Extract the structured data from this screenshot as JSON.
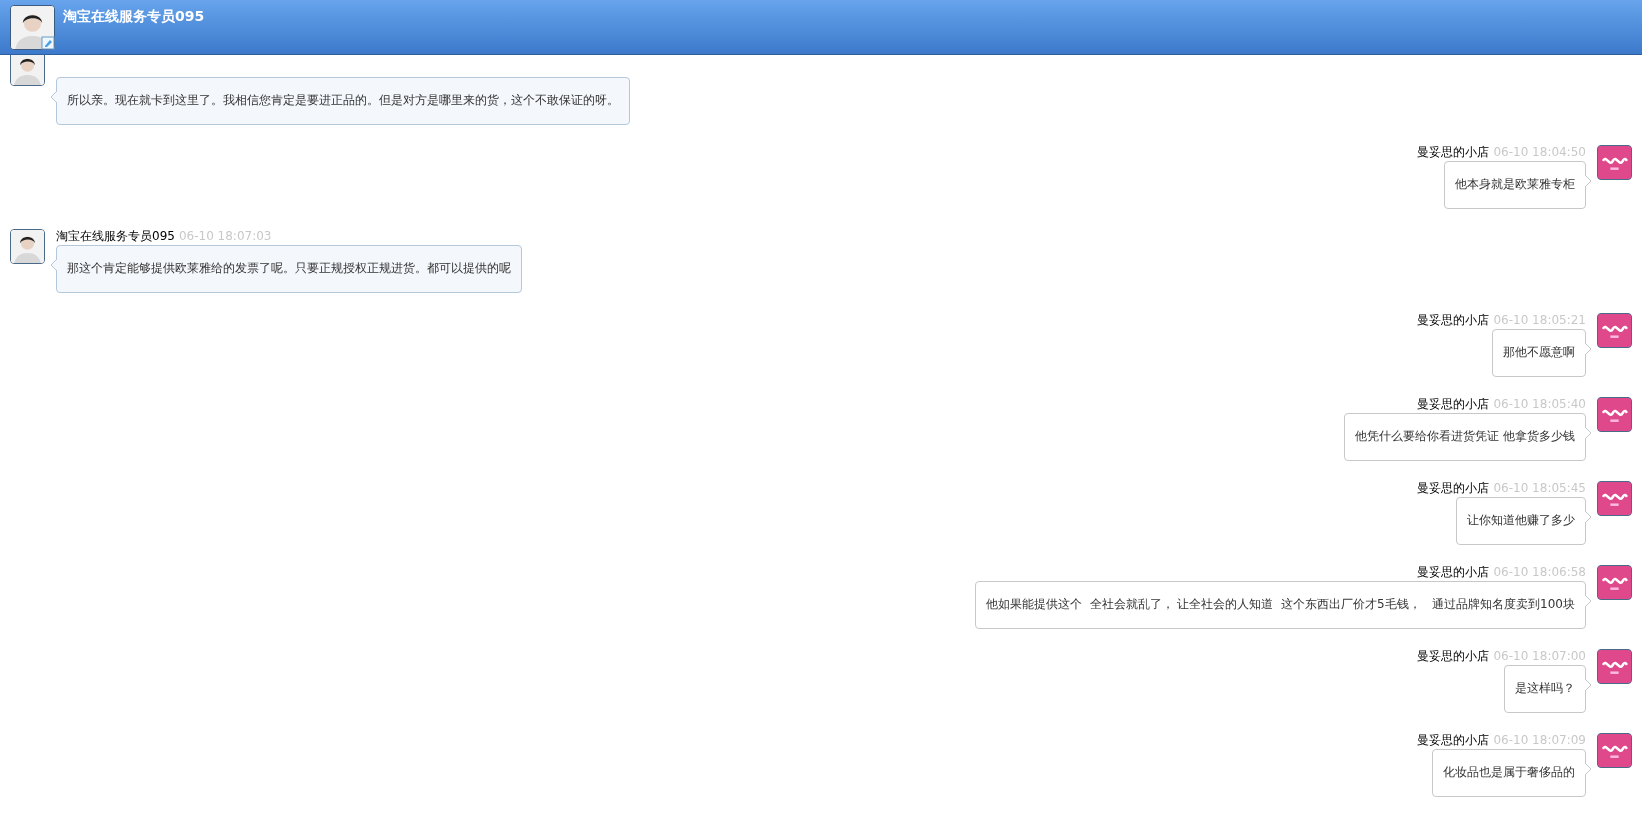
{
  "header": {
    "title": "淘宝在线服务专员095"
  },
  "messages": [
    {
      "kind": "incoming",
      "text": "所以亲。现在就卡到这里了。我相信您肯定是要进正品的。但是对方是哪里来的货，这个不敢保证的呀。"
    },
    {
      "kind": "outgoing",
      "sender": "曼妥思的小店",
      "time": "06-10 18:04:50",
      "text": "他本身就是欧莱雅专柜"
    },
    {
      "kind": "incoming",
      "sender": "淘宝在线服务专员095",
      "time": "06-10 18:07:03",
      "text": "那这个肯定能够提供欧莱雅给的发票了呢。只要正规授权正规进货。都可以提供的呢"
    },
    {
      "kind": "outgoing",
      "sender": "曼妥思的小店",
      "time": "06-10 18:05:21",
      "text": "那他不愿意啊"
    },
    {
      "kind": "outgoing",
      "sender": "曼妥思的小店",
      "time": "06-10 18:05:40",
      "text": "他凭什么要给你看进货凭证 他拿货多少钱"
    },
    {
      "kind": "outgoing",
      "sender": "曼妥思的小店",
      "time": "06-10 18:05:45",
      "text": "让你知道他赚了多少"
    },
    {
      "kind": "outgoing",
      "sender": "曼妥思的小店",
      "time": "06-10 18:06:58",
      "text": "他如果能提供这个  全社会就乱了， 让全社会的人知道  这个东西出厂价才5毛钱，   通过品牌知名度卖到100块"
    },
    {
      "kind": "outgoing",
      "sender": "曼妥思的小店",
      "time": "06-10 18:07:00",
      "text": "是这样吗？"
    },
    {
      "kind": "outgoing",
      "sender": "曼妥思的小店",
      "time": "06-10 18:07:09",
      "text": "化妆品也是属于奢侈品的"
    }
  ]
}
